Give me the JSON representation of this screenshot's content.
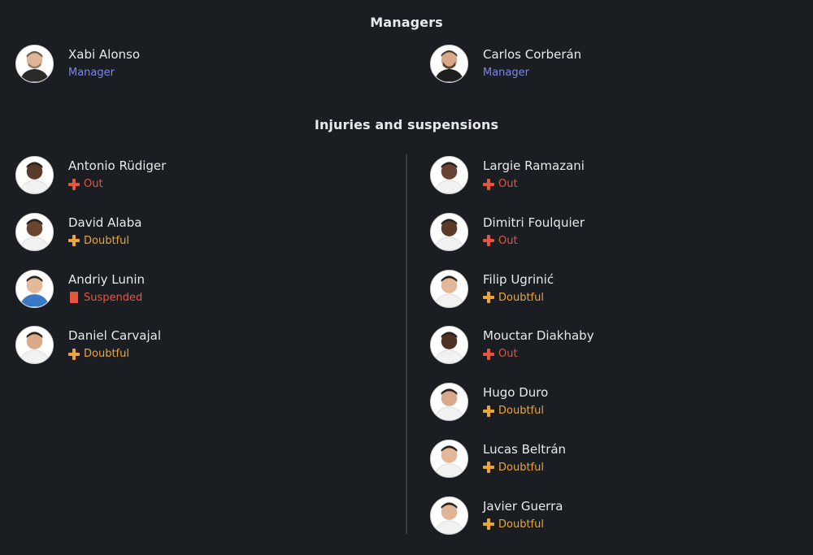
{
  "sections": {
    "managers_title": "Managers",
    "injuries_title": "Injuries and suspensions"
  },
  "managers": [
    {
      "name": "Xabi Alonso",
      "role": "Manager"
    },
    {
      "name": "Carlos Corberán",
      "role": "Manager"
    }
  ],
  "injuries_left": [
    {
      "name": "Antonio Rüdiger",
      "status": "Out",
      "type": "out",
      "skin": "#5a3a2a"
    },
    {
      "name": "David Alaba",
      "status": "Doubtful",
      "type": "doubtful",
      "skin": "#6b4530"
    },
    {
      "name": "Andriy Lunin",
      "status": "Suspended",
      "type": "suspended",
      "skin": "#e3b99a",
      "kit": "#3b78c4"
    },
    {
      "name": "Daniel Carvajal",
      "status": "Doubtful",
      "type": "doubtful",
      "skin": "#d9a98a"
    }
  ],
  "injuries_right": [
    {
      "name": "Largie Ramazani",
      "status": "Out",
      "type": "out",
      "skin": "#6a4330"
    },
    {
      "name": "Dimitri Foulquier",
      "status": "Out",
      "type": "out",
      "skin": "#5c3a28"
    },
    {
      "name": "Filip Ugrinić",
      "status": "Doubtful",
      "type": "doubtful",
      "skin": "#e1b898"
    },
    {
      "name": "Mouctar Diakhaby",
      "status": "Out",
      "type": "out",
      "skin": "#4e3122"
    },
    {
      "name": "Hugo Duro",
      "status": "Doubtful",
      "type": "doubtful",
      "skin": "#d8a88a"
    },
    {
      "name": "Lucas Beltrán",
      "status": "Doubtful",
      "type": "doubtful",
      "skin": "#e2b798"
    },
    {
      "name": "Javier Guerra",
      "status": "Doubtful",
      "type": "doubtful",
      "skin": "#e0b596"
    }
  ],
  "colors": {
    "background": "#1a1d21",
    "role": "#7b86f0",
    "out": "#e8553f",
    "doubtful": "#eaa638",
    "suspended": "#e8553f"
  },
  "icons": {
    "out": "red-cross-icon",
    "doubtful": "yellow-cross-icon",
    "suspended": "red-card-icon"
  }
}
